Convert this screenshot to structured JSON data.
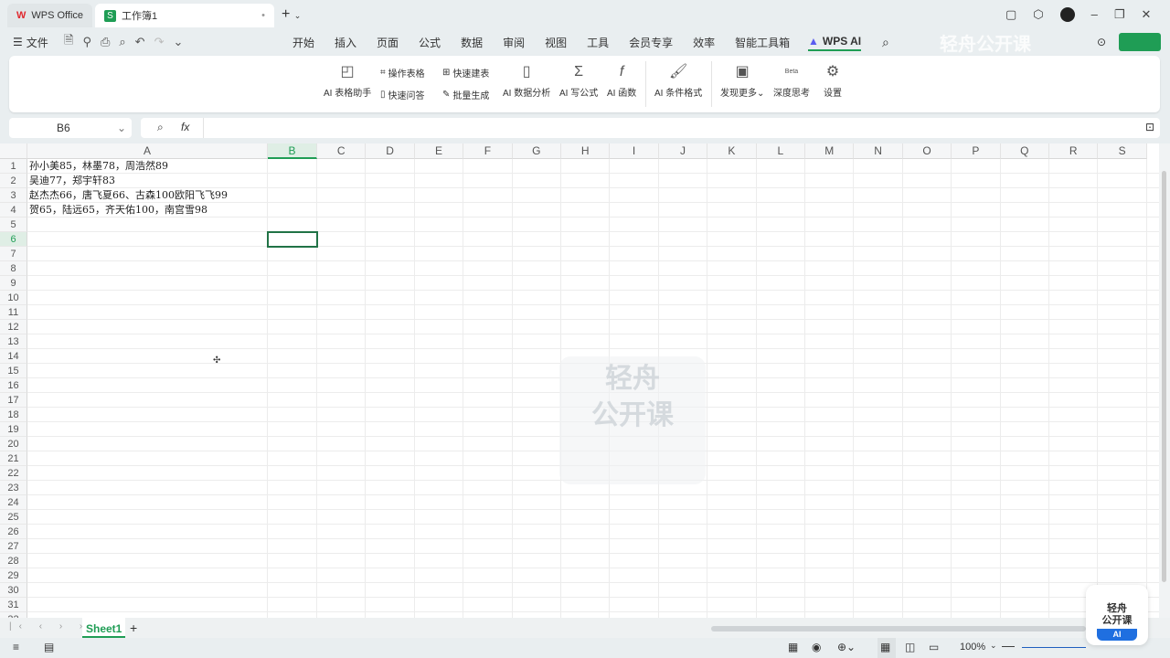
{
  "tabs": [
    {
      "label": "WPS Office"
    },
    {
      "label": "工作簿1"
    }
  ],
  "menu": {
    "file": "文件",
    "items": [
      "开始",
      "插入",
      "页面",
      "公式",
      "数据",
      "审阅",
      "视图",
      "工具",
      "会员专享",
      "效率",
      "智能工具箱"
    ],
    "wps_ai": "WPS AI",
    "watermark": "轻舟公开课"
  },
  "ribbon": {
    "ai_table_assistant": "AI 表格助手",
    "operate_table": "操作表格",
    "quick_build": "快速建表",
    "quick_qa": "快速问答",
    "batch_generate": "批量生成",
    "ai_data_analysis": "AI 数据分析",
    "ai_formula": "AI 写公式",
    "ai_function": "AI 函数",
    "ai_cond_format": "AI 条件格式",
    "discover_more": "发现更多",
    "deep_think": "深度思考",
    "beta": "Beta",
    "settings": "设置"
  },
  "formula_bar": {
    "name_box": "B6",
    "fx": "fx",
    "value": ""
  },
  "sheet": {
    "columns": [
      "A",
      "B",
      "C",
      "D",
      "E",
      "F",
      "G",
      "H",
      "I",
      "J",
      "K",
      "L",
      "M",
      "N",
      "O",
      "P",
      "Q",
      "R",
      "S"
    ],
    "rows": 32,
    "cells": [
      "孙小美85，林墨78，周浩然89",
      "吴迪77，郑宇轩83",
      "赵杰杰66，唐飞夏66、古森100欧阳飞飞99",
      "贺65，陆远65，齐天佑100，南宫雪98"
    ],
    "selected": "B6"
  },
  "sheet_tabs": {
    "active": "Sheet1",
    "add": "+"
  },
  "status": {
    "zoom": "100%"
  },
  "badge": {
    "line1": "轻舟",
    "line2": "公开课",
    "line3": "AI"
  },
  "colors": {
    "accent": "#1f9d55",
    "selection": "#217346"
  }
}
